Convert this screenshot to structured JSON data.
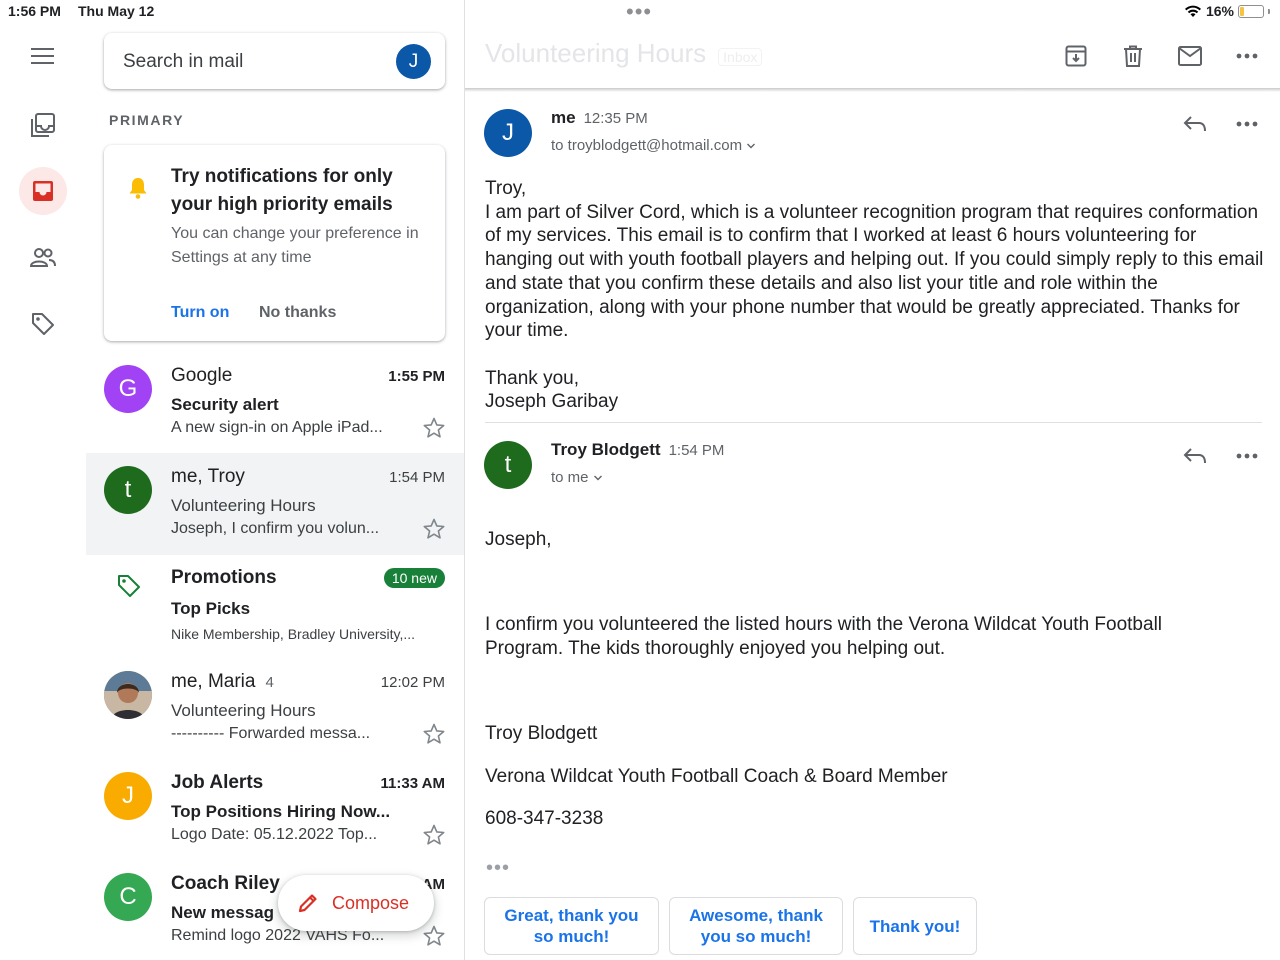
{
  "status_bar": {
    "time": "1:56 PM",
    "date": "Thu May 12",
    "battery": "16%",
    "battery_level": 0.16
  },
  "search": {
    "placeholder": "Search in mail",
    "account_initial": "J"
  },
  "section": {
    "label": "PRIMARY"
  },
  "notification": {
    "title": "Try notifications for only your high priority emails",
    "body": "You can change your preference in Settings at any time",
    "turn_on": "Turn on",
    "no_thanks": "No thanks"
  },
  "emails": [
    {
      "initial": "G",
      "color": "#a142f4",
      "sender": "Google",
      "time": "1:55 PM",
      "subject": "Security alert",
      "snippet": "A new sign-in on Apple iPad...",
      "unread": true
    },
    {
      "initial": "t",
      "color": "#1e6b1e",
      "sender": "me, Troy",
      "time": "1:54 PM",
      "subject": "Volunteering Hours",
      "snippet": "Joseph, I confirm you volun...",
      "unread": false,
      "selected": true
    },
    {
      "sender": "Promotions",
      "badge": "10 new",
      "subject": "Top Picks",
      "snippet": "Nike Membership, Bradley University,...",
      "unread": true
    },
    {
      "sender": "me, Maria",
      "count": "4",
      "time": "12:02 PM",
      "subject": "Volunteering Hours",
      "snippet": "---------- Forwarded messa...",
      "unread": false
    },
    {
      "initial": "J",
      "color": "#f9ab00",
      "sender": "Job Alerts",
      "time": "11:33 AM",
      "subject": "Top Positions Hiring Now...",
      "snippet": "Logo Date: 05.12.2022 Top...",
      "unread": true
    },
    {
      "initial": "C",
      "color": "#34a853",
      "sender": "Coach Riley",
      "time": "AM",
      "subject": "New messag",
      "snippet": "Remind logo 2022 VAHS Fo...",
      "unread": true
    }
  ],
  "compose": {
    "label": "Compose"
  },
  "thread": {
    "title": "Volunteering Hours",
    "label": "Inbox",
    "messages": [
      {
        "initial": "J",
        "color": "#0b57a8",
        "from": "me",
        "time": "12:35 PM",
        "to": "to troyblodgett@hotmail.com",
        "body": [
          "Troy,",
          "I am part of Silver Cord, which is a volunteer recognition program that requires conformation of my services. This email is to confirm that I worked at least 6 hours volunteering for hanging out with youth football players and helping out. If you could simply reply to this email and state that you confirm these details and also list your title and role within the organization, along with your phone number that would be greatly appreciated. Thanks for your time.",
          "Thank you,",
          "Joseph Garibay"
        ]
      },
      {
        "initial": "t",
        "color": "#1e6b1e",
        "from": "Troy Blodgett",
        "time": "1:54 PM",
        "to": "to me",
        "body": [
          "Joseph,",
          "I confirm you volunteered the listed hours with the Verona Wildcat Youth Football Program.  The kids thoroughly enjoyed you helping out.",
          "Troy Blodgett",
          "Verona Wildcat Youth Football Coach & Board Member",
          "608-347-3238"
        ]
      }
    ],
    "smart_replies": [
      "Great, thank you so much!",
      "Awesome, thank you so much!",
      "Thank you!"
    ]
  },
  "icons": [
    "menu-icon",
    "all-inboxes-icon",
    "inbox-icon",
    "contacts-icon",
    "label-icon",
    "bell-icon",
    "star-icon",
    "archive-icon",
    "trash-icon",
    "mail-icon",
    "more-icon",
    "reply-icon",
    "pencil-icon",
    "wifi-icon",
    "chevron-down-icon"
  ]
}
